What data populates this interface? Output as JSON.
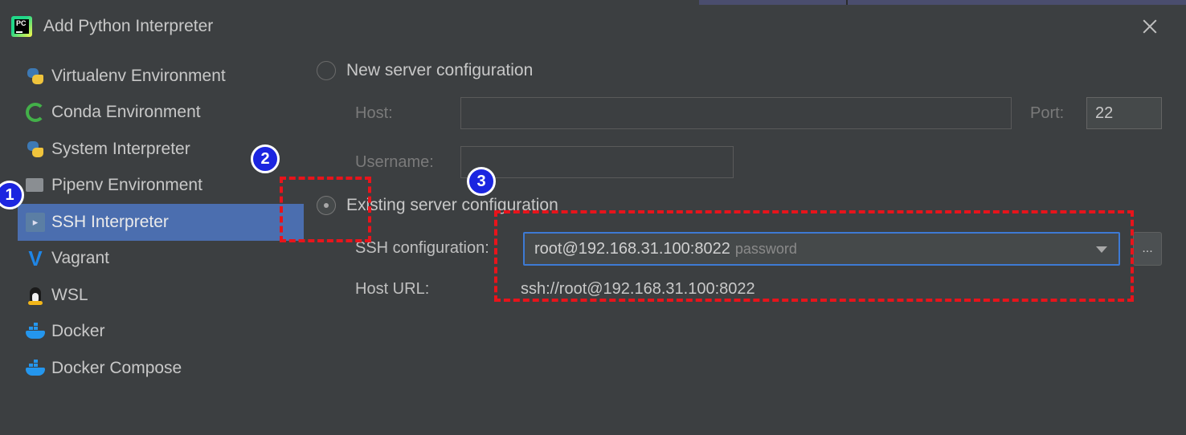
{
  "window": {
    "title": "Add Python Interpreter",
    "app_icon_text": "PC"
  },
  "sidebar": {
    "items": [
      {
        "label": "Virtualenv Environment",
        "icon": "python-icon"
      },
      {
        "label": "Conda Environment",
        "icon": "conda-icon"
      },
      {
        "label": "System Interpreter",
        "icon": "python-icon"
      },
      {
        "label": "Pipenv Environment",
        "icon": "pipenv-icon"
      },
      {
        "label": "SSH Interpreter",
        "icon": "ssh-icon",
        "selected": true
      },
      {
        "label": "Vagrant",
        "icon": "vagrant-icon"
      },
      {
        "label": "WSL",
        "icon": "linux-penguin-icon"
      },
      {
        "label": "Docker",
        "icon": "docker-icon"
      },
      {
        "label": "Docker Compose",
        "icon": "docker-compose-icon"
      }
    ]
  },
  "new_server": {
    "radio_label": "New server configuration",
    "host_label": "Host:",
    "host_value": "",
    "port_label": "Port:",
    "port_value": "22",
    "username_label": "Username:",
    "username_value": ""
  },
  "existing_server": {
    "radio_label": "Existing server configuration",
    "ssh_config_label": "SSH configuration:",
    "ssh_config_value": "root@192.168.31.100:8022",
    "ssh_config_hint": "password",
    "browse_label": "...",
    "host_url_label": "Host URL:",
    "host_url_value": "ssh://root@192.168.31.100:8022"
  },
  "annotations": {
    "badges": [
      "1",
      "2",
      "3"
    ],
    "callout_color": "#e8141b",
    "badge_color": "#1b25e0"
  },
  "colors": {
    "background": "#3c3f41",
    "selection": "#4b6eaf",
    "focus": "#3d7ad4"
  }
}
